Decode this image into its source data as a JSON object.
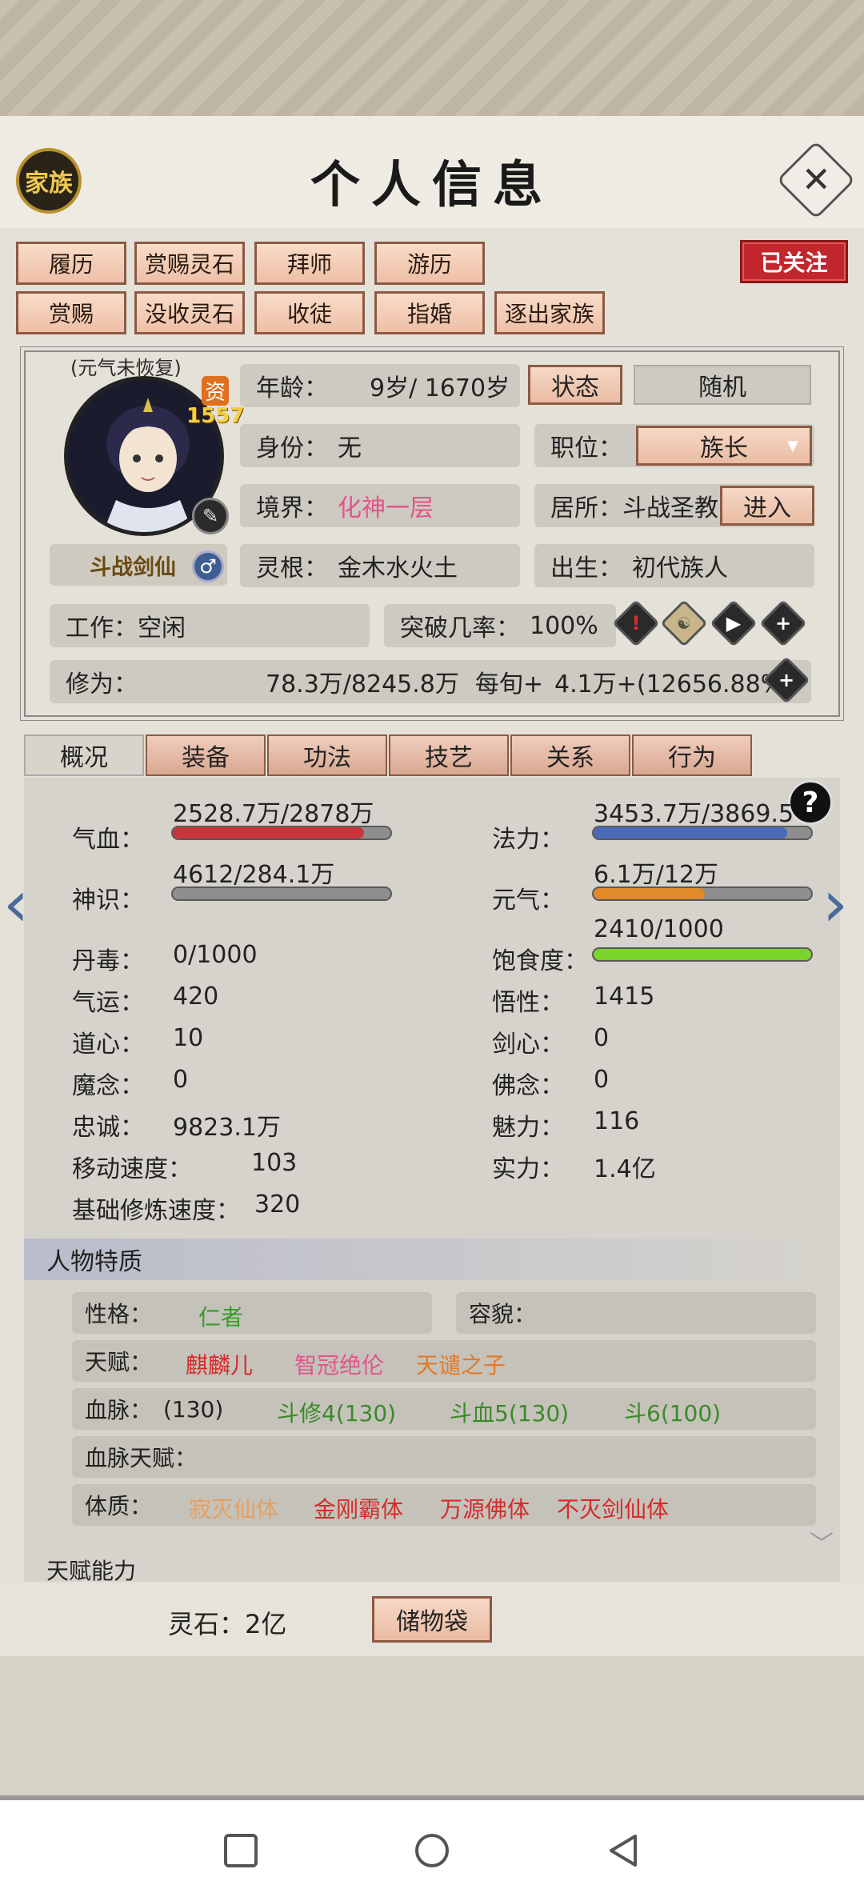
{
  "header": {
    "family_label": "家族",
    "title": "个人信息",
    "close_icon": "close-icon"
  },
  "actions_row1": [
    "履历",
    "赏赐灵石",
    "拜师",
    "游历"
  ],
  "actions_row2": [
    "赏赐",
    "没收灵石",
    "收徒",
    "指婚",
    "逐出家族"
  ],
  "follow_label": "已关注",
  "profile": {
    "avatar_note": "(元气未恢复)",
    "zi_label": "资",
    "zi_value": "1557",
    "name": "斗战剑仙",
    "gender_icon": "male-icon"
  },
  "fields": {
    "age_label": "年龄：",
    "age_value": "9岁/ 1670岁",
    "status_button": "状态",
    "random_button": "随机",
    "identity_label": "身份：",
    "identity_value": "无",
    "position_label": "职位：",
    "position_value": "族长",
    "realm_label": "境界：",
    "realm_value": "化神一层",
    "residence_label": "居所：",
    "residence_value": "斗战圣教",
    "enter_button": "进入",
    "root_label": "灵根：",
    "root_value": "金木水火土",
    "birth_label": "出生：",
    "birth_value": "初代族人",
    "work_label": "工作：",
    "work_value": "空闲",
    "breakthrough_label": "突破几率：",
    "breakthrough_value": "100%",
    "cultivation_label": "修为：",
    "cultivation_value": "78.3万/8245.8万",
    "per_period_label": "每旬+",
    "per_period_value": "4.1万+(12656.88%)"
  },
  "tabs": [
    "概况",
    "装备",
    "功法",
    "技艺",
    "关系",
    "行为"
  ],
  "stats": {
    "qixue_label": "气血：",
    "qixue_value": "2528.7万/2878万",
    "qixue_fill": 0.88,
    "fali_label": "法力：",
    "fali_value": "3453.7万/3869.5",
    "fali_fill": 0.89,
    "shenshi_label": "神识：",
    "shenshi_value": "4612/284.1万",
    "shenshi_fill": 0.0,
    "yuanqi_label": "元气：",
    "yuanqi_value": "6.1万/12万",
    "yuanqi_fill": 0.51,
    "baoshi_label": "饱食度：",
    "baoshi_value": "2410/1000",
    "baoshi_fill": 1.0,
    "dandu_label": "丹毒：",
    "dandu_value": "0/1000",
    "qiyun_label": "气运：",
    "qiyun_value": "420",
    "wuxing_label": "悟性：",
    "wuxing_value": "1415",
    "daoxin_label": "道心：",
    "daoxin_value": "10",
    "jianxin_label": "剑心：",
    "jianxin_value": "0",
    "monian_label": "魔念：",
    "monian_value": "0",
    "fonian_label": "佛念：",
    "fonian_value": "0",
    "zhongcheng_label": "忠诚：",
    "zhongcheng_value": "9823.1万",
    "meili_label": "魅力：",
    "meili_value": "116",
    "speed_label": "移动速度：",
    "speed_value": "103",
    "shili_label": "实力：",
    "shili_value": "1.4亿",
    "base_cult_label": "基础修炼速度：",
    "base_cult_value": "320"
  },
  "traits": {
    "section_title": "人物特质",
    "personality_label": "性格：",
    "personality_value": "仁者",
    "appearance_label": "容貌：",
    "talent_label": "天赋：",
    "talents": [
      "麒麟儿",
      "智冠绝伦",
      "天谴之子"
    ],
    "bloodline_label": "血脉：",
    "bloodlines": [
      "(130)",
      "斗修4(130)",
      "斗血5(130)",
      "斗6(100)"
    ],
    "bloodline_talent_label": "血脉天赋：",
    "physique_label": "体质：",
    "physiques": [
      "寂灭仙体",
      "金刚霸体",
      "万源佛体",
      "不灭剑仙体"
    ],
    "next_section": "天赋能力"
  },
  "footer": {
    "lingshi_label": "灵石：2亿",
    "bag_button": "储物袋"
  },
  "colors": {
    "accent_red": "#c1272d",
    "button_fill": "#eabca4",
    "bar_red": "#c9363a",
    "bar_blue": "#4a6ab8",
    "bar_orange": "#e08a2a",
    "bar_green": "#7ad42a"
  }
}
